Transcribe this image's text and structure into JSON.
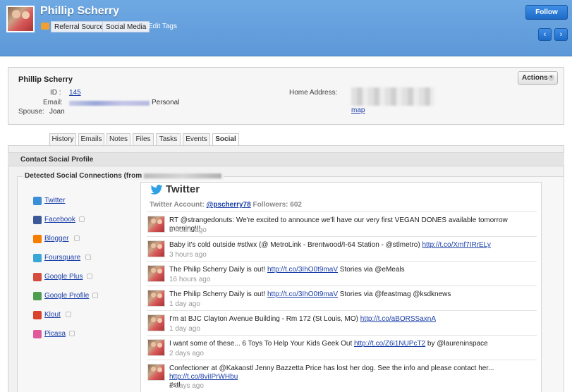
{
  "header": {
    "name": "Phillip Scherry",
    "tags": [
      "Referral Source",
      "Social Media"
    ],
    "edit_tags": "Edit Tags",
    "follow": "Follow",
    "prev": "‹",
    "next": "›"
  },
  "contact": {
    "name": "Phillip Scherry",
    "actions": "Actions",
    "id_label": "ID :",
    "id_value": "145",
    "email_label": "Email:",
    "email_type": "Personal",
    "spouse_label": "Spouse:",
    "spouse_value": "Joan",
    "home_address_label": "Home Address:",
    "map_link": "map"
  },
  "tabs": [
    "History",
    "Emails",
    "Notes",
    "Files",
    "Tasks",
    "Events",
    "Social"
  ],
  "social": {
    "profile_title": "Contact Social Profile",
    "detected_title": "Detected Social Connections (from",
    "networks": [
      {
        "name": "Twitter",
        "color": "#3a8fd6"
      },
      {
        "name": "Facebook",
        "color": "#3b5998"
      },
      {
        "name": "Blogger",
        "color": "#f57d00"
      },
      {
        "name": "Foursquare",
        "color": "#3aa6d6"
      },
      {
        "name": "Google Plus",
        "color": "#d54b3d"
      },
      {
        "name": "Google Profile",
        "color": "#4f9d4f"
      },
      {
        "name": "Klout",
        "color": "#d9422b"
      },
      {
        "name": "Picasa",
        "color": "#e05a9a"
      }
    ]
  },
  "twitter": {
    "title": "Twitter",
    "account_label": "Twitter Account:",
    "handle": "@pscherry78",
    "followers": "Followers: 602",
    "tweets": [
      {
        "text": "RT @strangedonuts: We're excited to announce we'll have our very first VEGAN DONES available tomorrow morning!!!",
        "link": "",
        "suffix": "",
        "text2": "",
        "time": "2 hours ago"
      },
      {
        "text": "Baby it's cold outside #stlwx (@ MetroLink - Brentwood/I-64 Station - @stlmetro) ",
        "link": "http://t.co/Xmf7IRrELy",
        "suffix": "",
        "text2": "",
        "time": "3 hours ago"
      },
      {
        "text": "The Philip Scherry Daily is out! ",
        "link": "http://t.co/3IhO0t9maV",
        "suffix": " Stories via @eMeals",
        "text2": "",
        "time": "16 hours ago"
      },
      {
        "text": "The Philip Scherry Daily is out! ",
        "link": "http://t.co/3IhO0t9maV",
        "suffix": " Stories via @feastmag @ksdknews",
        "text2": "",
        "time": "1 day ago"
      },
      {
        "text": "I'm at BJC Clayton Avenue Building - Rm 172 (St Louis, MO) ",
        "link": "http://t.co/aBORSSaxnA",
        "suffix": "",
        "text2": "",
        "time": "1 day ago"
      },
      {
        "text": "I want some of these... 6 Toys To Help Your Kids Geek Out ",
        "link": "http://t.co/Z6i1NUPcT2",
        "suffix": " by @laureninspace",
        "text2": "",
        "time": "2 days ago"
      },
      {
        "text": "Confectioner at @Kakaostl Jenny Bazzetta Price has lost her dog. See the info and please contact her... ",
        "link": "http://t.co/8viIPrWHbu",
        "suffix": "",
        "text2": "#stl",
        "time": "2 days ago"
      }
    ]
  }
}
